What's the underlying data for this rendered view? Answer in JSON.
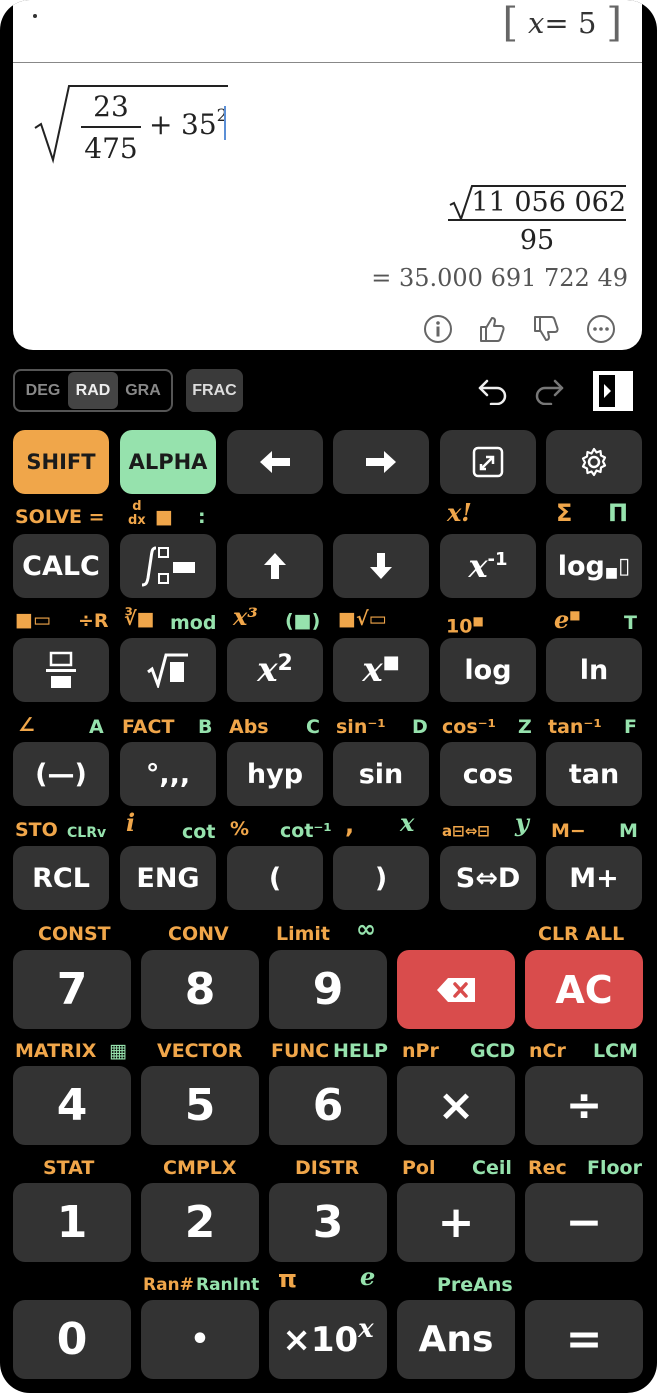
{
  "display": {
    "variable": {
      "name": "x",
      "eq": "=",
      "value": "5"
    },
    "input": {
      "num": "23",
      "den": "475",
      "plus": "+",
      "base": "35",
      "exp": "2"
    },
    "result": {
      "radicand": "11 056 062",
      "den": "95"
    },
    "decimal": "= 35.000 691 722 49"
  },
  "toolbar": {
    "modes": [
      "DEG",
      "RAD",
      "GRA"
    ],
    "selected_mode": "RAD",
    "frac": "FRAC"
  },
  "keys": {
    "shift": "SHIFT",
    "alpha": "ALPHA",
    "calc": "CALC",
    "log_base": "log",
    "log": "log",
    "ln": "ln",
    "neg": "(—)",
    "dms": "°,,,",
    "hyp": "hyp",
    "sin": "sin",
    "cos": "cos",
    "tan": "tan",
    "rcl": "RCL",
    "eng": "ENG",
    "lparen": "(",
    "rparen": ")",
    "sd": "S⇔D",
    "mplus": "M+",
    "d7": "7",
    "d8": "8",
    "d9": "9",
    "ac": "AC",
    "d4": "4",
    "d5": "5",
    "d6": "6",
    "mul": "×",
    "div": "÷",
    "d1": "1",
    "d2": "2",
    "d3": "3",
    "add": "+",
    "sub": "−",
    "d0": "0",
    "dot": "•",
    "exp10": "×10",
    "exp10_sup": "x",
    "ans": "Ans",
    "equals": "="
  },
  "labels": {
    "row1": {
      "solve": "SOLVE =",
      "colon": ":",
      "xfact": "x!",
      "sigma": "Σ",
      "pi_prod": "Π"
    },
    "row2": {
      "div_r": "÷R",
      "mod": "mod",
      "x3": "x³",
      "paren_box": "(■)",
      "ten": "10",
      "e": "e",
      "t": "T"
    },
    "row3": {
      "fact": "FACT",
      "abs": "Abs",
      "sin_inv": "sin⁻¹",
      "cos_inv": "cos⁻¹",
      "tan_inv": "tan⁻¹",
      "a": "A",
      "b": "B",
      "c": "C",
      "d": "D",
      "z": "Z",
      "f": "F"
    },
    "row4": {
      "sto": "STO",
      "clrv": "CLRv",
      "i": "i",
      "cot": "cot",
      "percent": "%",
      "cot_inv": "cot⁻¹",
      "comma": ",",
      "x": "x",
      "y": "y",
      "m_minus": "M−",
      "m": "M"
    },
    "row5": {
      "const": "CONST",
      "conv": "CONV",
      "limit": "Limit",
      "inf": "∞",
      "clr_all": "CLR ALL"
    },
    "row6": {
      "matrix": "MATRIX",
      "vector": "VECTOR",
      "func": "FUNC",
      "help": "HELP",
      "npr": "nPr",
      "gcd": "GCD",
      "ncr": "nCr",
      "lcm": "LCM"
    },
    "row7": {
      "stat": "STAT",
      "cmplx": "CMPLX",
      "distr": "DISTR",
      "pol": "Pol",
      "ceil": "Ceil",
      "rec": "Rec",
      "floor": "Floor"
    },
    "row8": {
      "ran": "Ran#",
      "ranint": "RanInt",
      "pi": "π",
      "e": "e",
      "preans": "PreAns"
    }
  },
  "colors": {
    "shift": "#f0a64a",
    "alpha": "#96e2ad",
    "key": "#333333",
    "red": "#d94c4c"
  },
  "icons": [
    "info-icon",
    "thumbs-up-icon",
    "thumbs-down-icon",
    "more-icon",
    "undo-icon",
    "redo-icon",
    "panel-toggle-icon",
    "arrow-left-icon",
    "arrow-right-icon",
    "resize-icon",
    "gear-icon",
    "arrow-up-icon",
    "arrow-down-icon",
    "backspace-icon"
  ]
}
